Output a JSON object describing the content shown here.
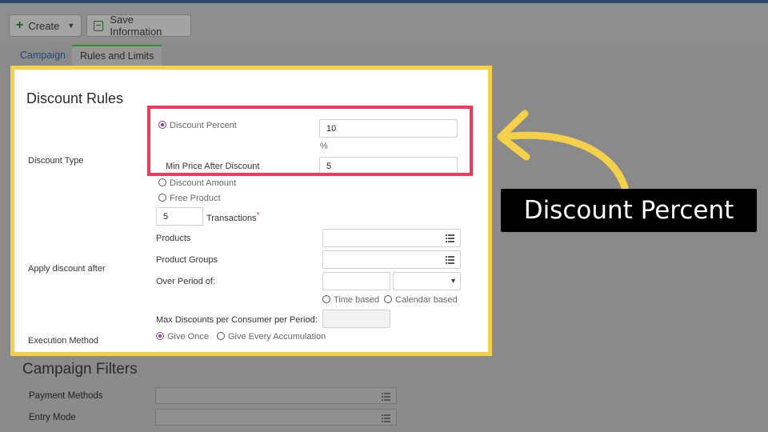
{
  "toolbar": {
    "create_label": "Create",
    "save_label": "Save Information"
  },
  "tabs": [
    {
      "label": "Campaign"
    },
    {
      "label": "Rules and Limits"
    }
  ],
  "discount_rules": {
    "title": "Discount Rules",
    "discount_type_label": "Discount Type",
    "discount_percent_label": "Discount Percent",
    "discount_percent_value": "10",
    "percent_suffix": "%",
    "min_price_label": "Min Price After Discount",
    "min_price_value": "5",
    "discount_amount_label": "Discount Amount",
    "free_product_label": "Free Product",
    "transactions_value": "5",
    "transactions_label": "Transactions",
    "required_marker": "*",
    "apply_discount_after_label": "Apply discount after",
    "products_label": "Products",
    "product_groups_label": "Product Groups",
    "over_period_label": "Over Period of:",
    "time_based_label": "Time based",
    "calendar_based_label": "Calendar based",
    "max_discounts_label": "Max Discounts per Consumer per Period:",
    "execution_method_label": "Execution Method",
    "give_once_label": "Give Once",
    "give_every_label": "Give Every Accumulation"
  },
  "campaign_filters": {
    "title": "Campaign Filters",
    "payment_methods_label": "Payment Methods",
    "entry_mode_label": "Entry Mode"
  },
  "callout": {
    "text": "Discount Percent"
  },
  "colors": {
    "highlight_border": "#f5d14a",
    "focus_box": "#ed3a5a",
    "arrow": "#f5d14a",
    "radio_selected": "#8a3aa8"
  }
}
